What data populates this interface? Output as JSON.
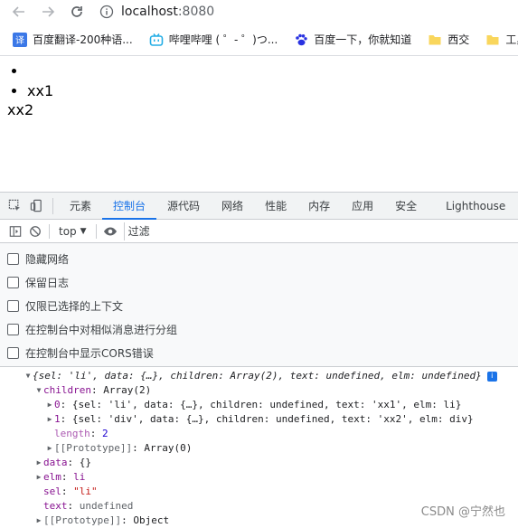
{
  "browser": {
    "url_host": "localhost",
    "url_port": ":8080",
    "bookmarks": [
      {
        "label": "百度翻译-200种语...",
        "icon": "translate-icon",
        "icon_text": "译",
        "color": "#3b78e7"
      },
      {
        "label": "哔哩哔哩 ( ゜- ゜)つ...",
        "icon": "bilibili-icon",
        "color": "#23ade5"
      },
      {
        "label": "百度一下，你就知道",
        "icon": "baidu-paw-icon",
        "color": "#2932e1"
      },
      {
        "label": "西交",
        "icon": "folder-icon",
        "color": "#f9d65c"
      },
      {
        "label": "工具",
        "icon": "folder-icon",
        "color": "#f9d65c"
      }
    ]
  },
  "page": {
    "li_items": [
      "",
      "xx1"
    ],
    "div_text": "xx2"
  },
  "devtools": {
    "tabs": [
      "元素",
      "控制台",
      "源代码",
      "网络",
      "性能",
      "内存",
      "应用",
      "安全",
      "Lighthouse"
    ],
    "active_tab": "控制台",
    "context": "top",
    "filter_placeholder": "过滤",
    "settings": [
      "隐藏网络",
      "保留日志",
      "仅限已选择的上下文",
      "在控制台中对相似消息进行分组",
      "在控制台中显示CORS错误"
    ]
  },
  "console": {
    "summary": "{sel: 'li', data: {…}, children: Array(2), text: undefined, elm: undefined}",
    "info_badge": "i",
    "children_key": "children",
    "children_val": "Array(2)",
    "child0_idx": "0",
    "child0_val": "{sel: 'li', data: {…}, children: undefined, text: 'xx1', elm: li}",
    "child1_idx": "1",
    "child1_val": "{sel: 'div', data: {…}, children: undefined, text: 'xx2', elm: div}",
    "length_key": "length",
    "length_val": "2",
    "proto_inner_key": "[[Prototype]]",
    "proto_inner_val": "Array(0)",
    "data_key": "data",
    "data_val": "{}",
    "elm_key": "elm",
    "elm_val": "li",
    "sel_key": "sel",
    "sel_val": "\"li\"",
    "text_key": "text",
    "text_val": "undefined",
    "proto_key": "[[Prototype]]",
    "proto_val": "Object"
  },
  "watermark": "CSDN @宁然也"
}
